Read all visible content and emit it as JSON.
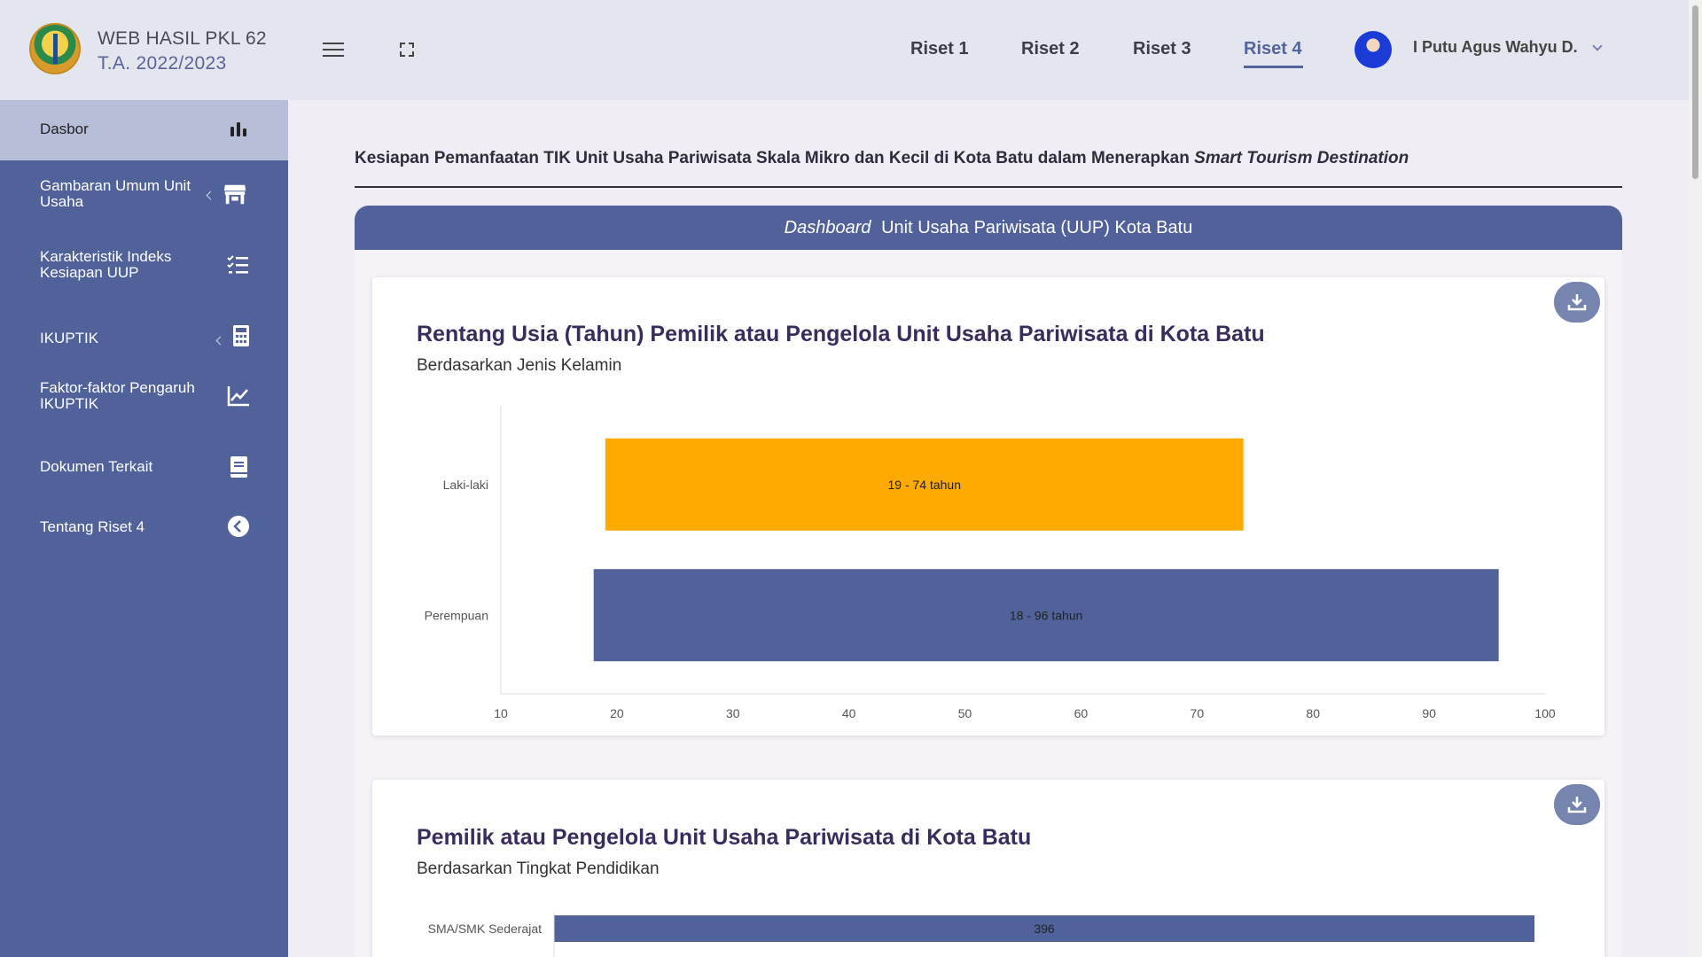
{
  "header": {
    "brand_line1": "WEB HASIL PKL 62",
    "brand_line2": "T.A. 2022/2023",
    "nav": [
      "Riset 1",
      "Riset 2",
      "Riset 3",
      "Riset 4"
    ],
    "active_nav": "Riset 4",
    "username": "I Putu Agus Wahyu D."
  },
  "sidebar": {
    "items": [
      {
        "label": "Dasbor",
        "icon": "bar-chart-icon",
        "active": true
      },
      {
        "label": "Gambaran Umum Unit Usaha",
        "icon": "store-icon"
      },
      {
        "label": "Karakteristik Indeks Kesiapan UUP",
        "icon": "checklist-icon"
      },
      {
        "label": "IKUPTIK",
        "icon": "calculator-icon"
      },
      {
        "label": "Faktor-faktor Pengaruh IKUPTIK",
        "icon": "line-chart-icon"
      },
      {
        "label": "Dokumen Terkait",
        "icon": "book-icon"
      },
      {
        "label": "Tentang Riset 4",
        "icon": "chevron-circle-icon"
      }
    ]
  },
  "main": {
    "title": "Kesiapan Pemanfaatan TIK Unit Usaha Pariwisata Skala Mikro dan Kecil di Kota Batu dalam Menerapkan",
    "title_italic": "Smart Tourism Destination",
    "panel_header_italic": "Dashboard",
    "panel_header": "Unit Usaha Pariwisata (UUP) Kota Batu"
  },
  "chart_data": [
    {
      "type": "bar",
      "orientation": "horizontal-range",
      "title": "Rentang Usia (Tahun) Pemilik atau Pengelola Unit Usaha Pariwisata di Kota Batu",
      "subtitle": "Berdasarkan Jenis Kelamin",
      "categories": [
        "Laki-laki",
        "Perempuan"
      ],
      "ranges": [
        [
          19,
          74
        ],
        [
          18,
          96
        ]
      ],
      "data_labels": [
        "19 - 74 tahun",
        "18 - 96 tahun"
      ],
      "colors": [
        "#ffaa00",
        "#51629a"
      ],
      "xlim": [
        10,
        100
      ],
      "xticks": [
        10,
        20,
        30,
        40,
        50,
        60,
        70,
        80,
        90,
        100
      ],
      "grid": false
    },
    {
      "type": "bar",
      "orientation": "horizontal",
      "title": "Pemilik atau Pengelola Unit Usaha Pariwisata di Kota Batu",
      "subtitle": "Berdasarkan Tingkat Pendidikan",
      "categories": [
        "SMA/SMK Sederajat"
      ],
      "values": [
        396
      ],
      "colors": [
        "#51629a"
      ]
    }
  ]
}
